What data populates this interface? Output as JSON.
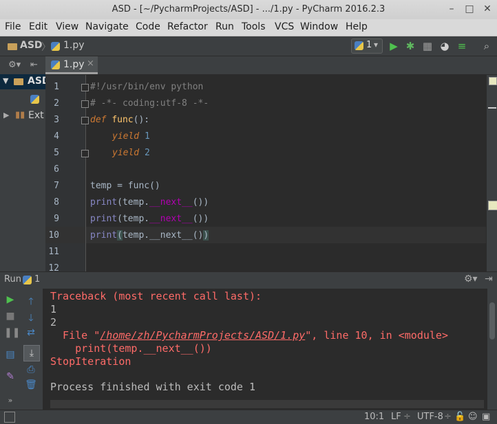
{
  "window": {
    "title": "ASD - [~/PycharmProjects/ASD] - .../1.py - PyCharm 2016.2.3",
    "minimize": "–",
    "maximize": "□",
    "close": "✕"
  },
  "menu": [
    "File",
    "Edit",
    "View",
    "Navigate",
    "Code",
    "Refactor",
    "Run",
    "Tools",
    "VCS",
    "Window",
    "Help"
  ],
  "breadcrumb": {
    "project": "ASD",
    "file": "1.py",
    "sep": "〉"
  },
  "toolbar": {
    "run_config": "1",
    "dropdown": "▾"
  },
  "sidebar": {
    "items": [
      {
        "label": "ASD"
      },
      {
        "label": "Ext"
      }
    ]
  },
  "editor": {
    "tab_label": "1.py",
    "tab_close": "×",
    "line_numbers": [
      "1",
      "2",
      "3",
      "4",
      "5",
      "6",
      "7",
      "8",
      "9",
      "10",
      "11",
      "12"
    ],
    "lines": {
      "l1": "#!/usr/bin/env python",
      "l2": "# -*- coding:utf-8 -*-",
      "l3_kw": "def",
      "l3_fn": "func",
      "l3_rest": "():",
      "l4_kw": "yield",
      "l4_num": "1",
      "l5_kw": "yield",
      "l5_num": "2",
      "l7": "temp = func()",
      "print": "print",
      "call_open": "(temp.",
      "call_dunder": "__next__",
      "call_close": "())",
      "l10_open": "(",
      "l10_mid": "temp.__next__()",
      "l10_close": ")"
    }
  },
  "run_panel": {
    "label": "Run",
    "config": "1",
    "console": {
      "l1": "Traceback (most recent call last):",
      "l2": "1",
      "l3": "2",
      "l4_pre": "  File \"",
      "l4_link": "/home/zh/PycharmProjects/ASD/1.py",
      "l4_post": "\", line 10, in <module>",
      "l5": "    print(temp.__next__())",
      "l6": "StopIteration",
      "l7": "Process finished with exit code 1"
    }
  },
  "status": {
    "position": "10:1",
    "line_sep": "LF",
    "encoding": "UTF-8",
    "line_sep_arrow": "÷",
    "encoding_arrow": "÷"
  },
  "colors": {
    "accent": "#4a88c7",
    "run_green": "#499c54",
    "error": "#ff6b68"
  }
}
